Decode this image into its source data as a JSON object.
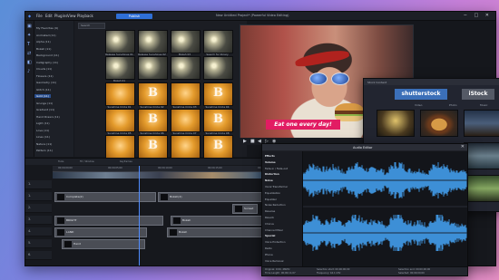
{
  "menu": [
    "File",
    "Edit",
    "Plugins",
    "View",
    "Playback"
  ],
  "publish": "Publish",
  "project_title": "New Untitled Project* (Powerful Video Editing)",
  "library": {
    "search": "Search",
    "tree": [
      "My Favorites (9)",
      "Animated (11)",
      "Alpha (11)",
      "Bokeh (11)",
      "Background (11)",
      "Calligraphy (11)",
      "Clouds (11)",
      "Flowers (11)",
      "Geometry (11)",
      "Glitch (11)",
      "Gold (11)",
      "Grunge (11)",
      "Gradient (11)",
      "Hand Drawn (11)",
      "Light (11)",
      "Love (11)",
      "Lines (11)",
      "Nature (11)",
      "Pattern (11)"
    ],
    "selected": "Gold (11)",
    "thumbs_row1": [
      "Release Sunshines 01",
      "Release Sunshines 02",
      "Bokeh 03",
      "Search for library"
    ],
    "thumbs_row2": [
      "Bokeh 01",
      "",
      "",
      ""
    ],
    "thumbs_row3": [
      "Sunshine Circle 01",
      "Sunshine Circle 02",
      "Sunshine Circle 03",
      "Sunshine Circle 04"
    ],
    "thumbs_row4": [
      "Sunshine Circle 05",
      "Sunshine Circle 06",
      "Sunshine Circle 07",
      "Sunshine Circle 08"
    ],
    "thumbs_row5": [
      "",
      "",
      "",
      ""
    ]
  },
  "preview": {
    "caption": "Eat one every day!"
  },
  "timeline": {
    "toolbar": [
      "Tools",
      "Fit / Window",
      "Keyframes"
    ],
    "ticks": [
      "00;00;00;00",
      "00;00;05;00",
      "00;00;10;00",
      "00;00;15;00",
      "00;00;20;00",
      "00;00;25;00",
      "00;00;30;00",
      "00;00;35;00",
      "00;00;40;00"
    ],
    "tracks": [
      "1.",
      "1.",
      "2.",
      "3.",
      "4.",
      "5.",
      "6."
    ],
    "clips": [
      "Complete(2)",
      "Bokeh(2)",
      "Sunset",
      "BRIGHT",
      "Bokeh",
      "LAND",
      "Bokeh",
      "Hand"
    ]
  },
  "producer": {
    "bar": "Stock Content",
    "shutterstock": "shutterstock",
    "istock": "iStock",
    "tabs": [
      "Video",
      "Photo",
      "Music"
    ]
  },
  "audio_editor": {
    "title": "Audio Editor",
    "effects": [
      "Effects",
      "Volume",
      "Fade-in / Fade-out",
      "Distortion",
      "Noise",
      "Vocal Transformer",
      "Equalization",
      "Equalizer",
      "Noise Reduction",
      "Reverse",
      "Reverb",
      "Chorus",
      "Channel Mixer",
      "Special",
      "Voice Protection",
      "Radio",
      "Phone",
      "Voice Removal"
    ],
    "status": [
      "Original: 0:00, 48kHz",
      "Time Length: 00;00;11;07",
      "Selection start: 00;00;00;00",
      "Frequency: 44.1 kHz",
      "Selection end: 00;00;00;00",
      "Selected: 00;00;00;00"
    ]
  }
}
